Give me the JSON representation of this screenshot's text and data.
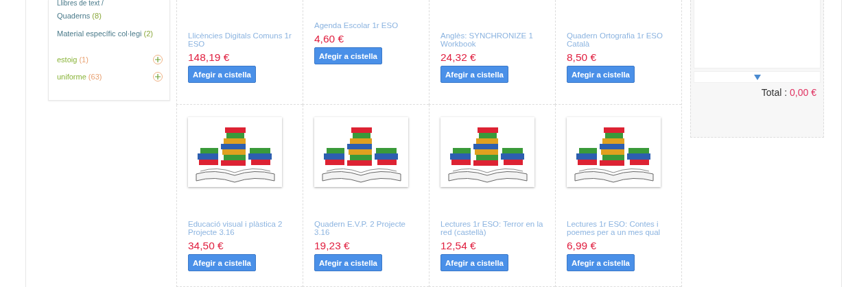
{
  "sidebar": {
    "items": [
      {
        "kind": "link",
        "label": "Llibres de text /"
      },
      {
        "kind": "link",
        "label": "Quaderns",
        "count": "(8)"
      },
      {
        "kind": "link",
        "label": "Material específic col·legi",
        "count": "(2)"
      },
      {
        "kind": "expandable",
        "label": "estoig",
        "count": "(1)",
        "expanded": false
      },
      {
        "kind": "expandable",
        "label": "uniforme",
        "count": "(63)",
        "expanded": false
      }
    ]
  },
  "products": [
    {
      "image": false,
      "title": "Llicències Digitals Comuns 1r ESO",
      "price": "148,19 €",
      "button": "Afegir a cistella"
    },
    {
      "image": false,
      "title": "Agenda Escolar 1r ESO",
      "price": "4,60 €",
      "button": "Afegir a cistella"
    },
    {
      "image": false,
      "title": "Anglès: SYNCHRONIZE 1 Workbook",
      "price": "24,32 €",
      "button": "Afegir a cistella"
    },
    {
      "image": false,
      "title": "Quadern Ortografia 1r ESO Català",
      "price": "8,50 €",
      "button": "Afegir a cistella"
    },
    {
      "image": true,
      "title": "Educació visual i plàstica 2 Projecte 3.16",
      "price": "34,50 €",
      "button": "Afegir a cistella"
    },
    {
      "image": true,
      "title": "Quadern E.V.P. 2 Projecte 3.16",
      "price": "19,23 €",
      "button": "Afegir a cistella"
    },
    {
      "image": true,
      "title": "Lectures 1r ESO: Terror en la red (castellà)",
      "price": "12,54 €",
      "button": "Afegir a cistella"
    },
    {
      "image": true,
      "title": "Lectures 1r ESO: Contes i poemes per a un mes qual",
      "price": "6,99 €",
      "button": "Afegir a cistella"
    }
  ],
  "cart": {
    "total_label": "Total :",
    "total_value": "0,00 €"
  }
}
